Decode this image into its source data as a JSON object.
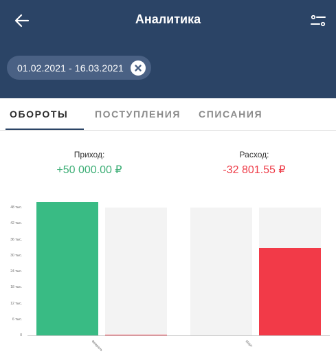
{
  "header": {
    "title": "Аналитика",
    "back_icon": "arrow-left-icon",
    "filter_icon": "sliders-icon",
    "background": "#2b4466"
  },
  "date_chip": {
    "label": "01.02.2021 - 16.03.2021",
    "close_icon": "close-circle-icon"
  },
  "tabs": [
    {
      "label": "ОБОРОТЫ",
      "active": true
    },
    {
      "label": "ПОСТУПЛЕНИЯ",
      "active": false
    },
    {
      "label": "СПИСАНИЯ",
      "active": false
    }
  ],
  "summary": {
    "income_label": "Приход:",
    "income_value": "+50 000.00 ₽",
    "income_color": "#3dae76",
    "expense_label": "Расход:",
    "expense_value": "-32 801.55 ₽",
    "expense_color": "#ee3d49"
  },
  "chart_data": {
    "type": "bar",
    "categories": [
      "Февраль",
      "Март"
    ],
    "series": [
      {
        "values": [
          50000,
          0
        ],
        "color": "#39bb84"
      },
      {
        "values": [
          300,
          32801.55
        ],
        "color": "#f23a48"
      }
    ],
    "yticks": [
      "0",
      "6 тыс.",
      "12 тыс.",
      "18 тыс.",
      "24 тыс.",
      "30 тыс.",
      "36 тыс.",
      "42 тыс.",
      "48 тыс."
    ],
    "ylim": [
      0,
      48000
    ],
    "background_bar_color": "#f3f3f3"
  }
}
